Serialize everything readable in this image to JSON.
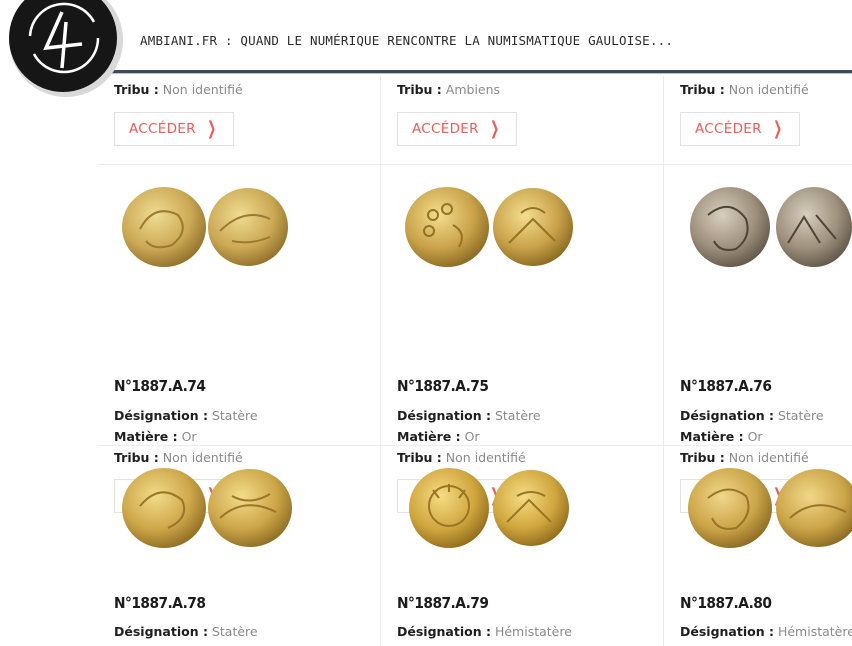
{
  "header": {
    "site_title": "AMBIANI.FR : QUAND LE NUMÉRIQUE RENCONTRE LA NUMISMATIQUE GAULOISE..."
  },
  "labels": {
    "designation": "Désignation :",
    "matiere": "Matière :",
    "tribu": "Tribu :",
    "access": "ACCÉDER"
  },
  "rows": [
    {
      "cells": [
        {
          "tribu": "Non identifié"
        },
        {
          "tribu": "Ambiens"
        },
        {
          "tribu": "Non identifié"
        }
      ]
    },
    {
      "cells": [
        {
          "id": "N°1887.A.74",
          "designation": "Statère",
          "matiere": "Or",
          "tribu": "Non identifié"
        },
        {
          "id": "N°1887.A.75",
          "designation": "Statère",
          "matiere": "Or",
          "tribu": "Non identifié"
        },
        {
          "id": "N°1887.A.76",
          "designation": "Statère",
          "matiere": "Or",
          "tribu": "Non identifié"
        }
      ]
    },
    {
      "cells": [
        {
          "id": "N°1887.A.78",
          "designation": "Statère"
        },
        {
          "id": "N°1887.A.79",
          "designation": "Hémistatère"
        },
        {
          "id": "N°1887.A.80",
          "designation": "Hémistatère"
        }
      ]
    }
  ],
  "colors": {
    "accent": "#f05a5a",
    "header_line": "#3f4a5a",
    "gold": "#c9a74a",
    "silver": "#8f8678"
  }
}
